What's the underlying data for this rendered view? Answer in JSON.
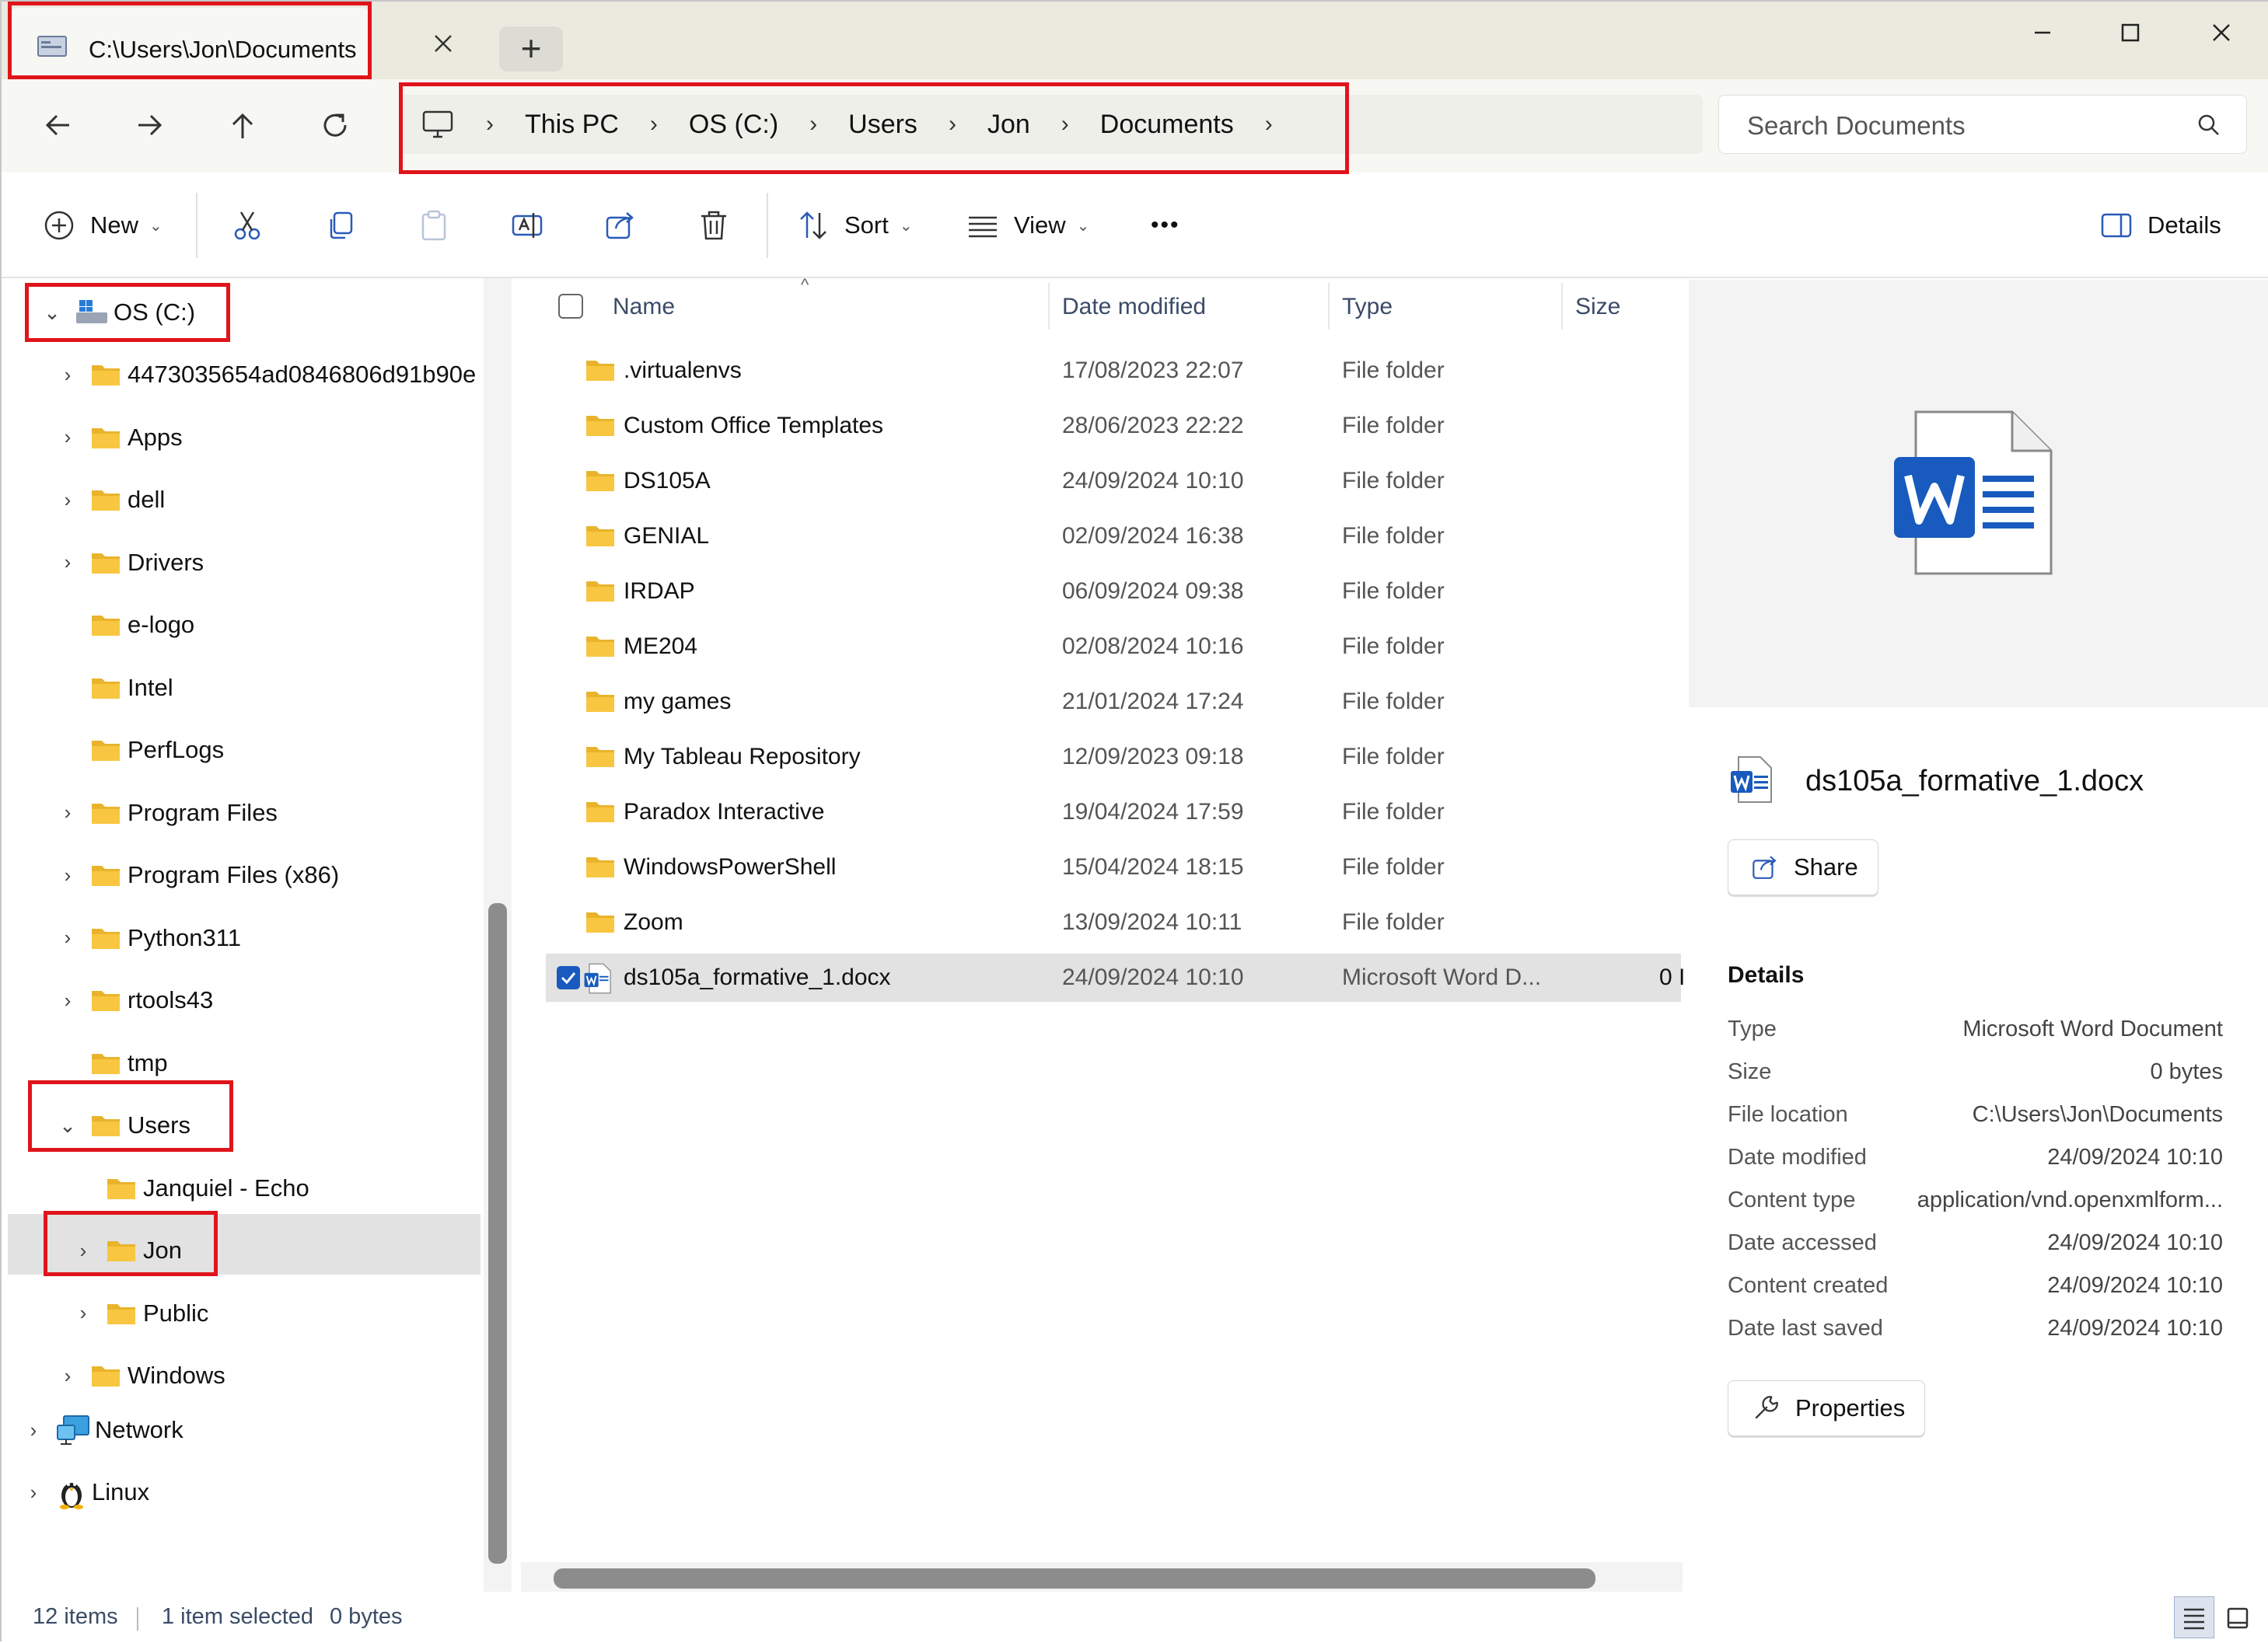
{
  "window": {
    "tab_title": "C:\\Users\\Jon\\Documents",
    "new_tab": "+",
    "controls": [
      "minimize",
      "maximize",
      "close"
    ]
  },
  "nav": {
    "breadcrumb": [
      "This PC",
      "OS (C:)",
      "Users",
      "Jon",
      "Documents"
    ],
    "search_placeholder": "Search Documents"
  },
  "toolbar": {
    "new_label": "New",
    "sort_label": "Sort",
    "view_label": "View",
    "more_label": "•••",
    "details_label": "Details"
  },
  "sidebar": {
    "drive": "OS (C:)",
    "folders": [
      {
        "label": "4473035654ad0846806d91b90e",
        "expandable": true
      },
      {
        "label": "Apps",
        "expandable": true
      },
      {
        "label": "dell",
        "expandable": true
      },
      {
        "label": "Drivers",
        "expandable": true
      },
      {
        "label": "e-logo",
        "expandable": false
      },
      {
        "label": "Intel",
        "expandable": false
      },
      {
        "label": "PerfLogs",
        "expandable": false
      },
      {
        "label": "Program Files",
        "expandable": true
      },
      {
        "label": "Program Files (x86)",
        "expandable": true
      },
      {
        "label": "Python311",
        "expandable": true
      },
      {
        "label": "rtools43",
        "expandable": true
      },
      {
        "label": "tmp",
        "expandable": false
      },
      {
        "label": "Users",
        "expandable": true
      }
    ],
    "users_children": [
      {
        "label": "Janquiel - Echo",
        "expandable": false
      },
      {
        "label": "Jon",
        "expandable": true
      },
      {
        "label": "Public",
        "expandable": true
      }
    ],
    "windows": "Windows",
    "network": "Network",
    "linux": "Linux"
  },
  "filelist": {
    "columns": [
      "Name",
      "Date modified",
      "Type",
      "Size"
    ],
    "rows": [
      {
        "name": ".virtualenvs",
        "date": "17/08/2023 22:07",
        "type": "File folder",
        "size": ""
      },
      {
        "name": "Custom Office Templates",
        "date": "28/06/2023 22:22",
        "type": "File folder",
        "size": ""
      },
      {
        "name": "DS105A",
        "date": "24/09/2024 10:10",
        "type": "File folder",
        "size": ""
      },
      {
        "name": "GENIAL",
        "date": "02/09/2024 16:38",
        "type": "File folder",
        "size": ""
      },
      {
        "name": "IRDAP",
        "date": "06/09/2024 09:38",
        "type": "File folder",
        "size": ""
      },
      {
        "name": "ME204",
        "date": "02/08/2024 10:16",
        "type": "File folder",
        "size": ""
      },
      {
        "name": "my games",
        "date": "21/01/2024 17:24",
        "type": "File folder",
        "size": ""
      },
      {
        "name": "My Tableau Repository",
        "date": "12/09/2023 09:18",
        "type": "File folder",
        "size": ""
      },
      {
        "name": "Paradox Interactive",
        "date": "19/04/2024 17:59",
        "type": "File folder",
        "size": ""
      },
      {
        "name": "WindowsPowerShell",
        "date": "15/04/2024 18:15",
        "type": "File folder",
        "size": ""
      },
      {
        "name": "Zoom",
        "date": "13/09/2024 10:11",
        "type": "File folder",
        "size": ""
      },
      {
        "name": "ds105a_formative_1.docx",
        "date": "24/09/2024 10:10",
        "type": "Microsoft Word D...",
        "size": "0 I"
      }
    ]
  },
  "details": {
    "file_name": "ds105a_formative_1.docx",
    "share_label": "Share",
    "section_title": "Details",
    "props": [
      {
        "label": "Type",
        "value": "Microsoft Word Document"
      },
      {
        "label": "Size",
        "value": "0 bytes"
      },
      {
        "label": "File location",
        "value": "C:\\Users\\Jon\\Documents"
      },
      {
        "label": "Date modified",
        "value": "24/09/2024 10:10"
      },
      {
        "label": "Content type",
        "value": "application/vnd.openxmlform..."
      },
      {
        "label": "Date accessed",
        "value": "24/09/2024 10:10"
      },
      {
        "label": "Content created",
        "value": "24/09/2024 10:10"
      },
      {
        "label": "Date last saved",
        "value": "24/09/2024 10:10"
      }
    ],
    "properties_label": "Properties"
  },
  "status": {
    "items": "12 items",
    "selected": "1 item selected",
    "size": "0 bytes"
  },
  "colors": {
    "highlight": "#e0141b",
    "folder": "#f8c640",
    "word_blue": "#185abd",
    "selection": "#e2e2e2"
  }
}
